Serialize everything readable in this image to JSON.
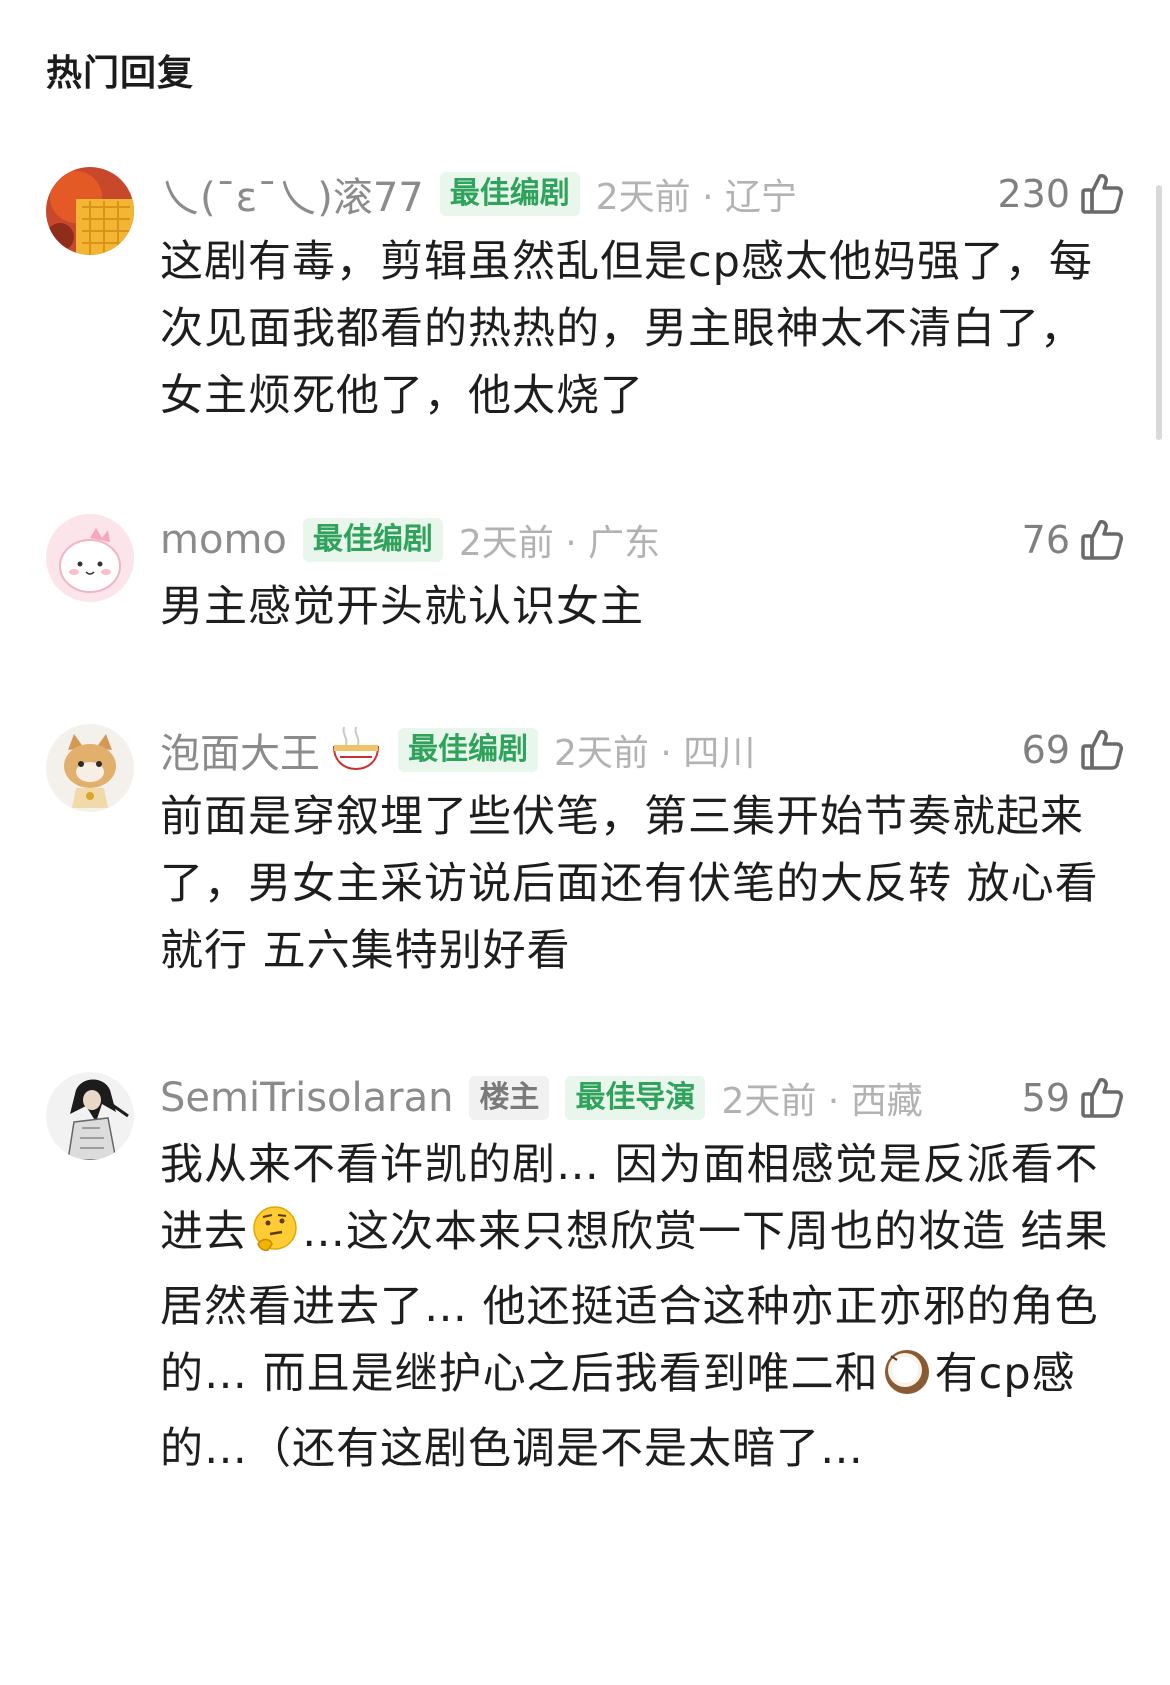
{
  "section_title": "热门回复",
  "comments": [
    {
      "username": "乀(ˉεˉ乀)滚77",
      "badges": [
        "最佳编剧"
      ],
      "time": "2天前",
      "location": "辽宁",
      "likes": "230",
      "text": "这剧有毒，剪辑虽然乱但是cp感太他妈强了，每次见面我都看的热热的，男主眼神太不清白了，女主烦死他了，他太烧了",
      "avatar_icon": "mango-avatar-icon"
    },
    {
      "username": "momo",
      "badges": [
        "最佳编剧"
      ],
      "time": "2天前",
      "location": "广东",
      "likes": "76",
      "text": "男主感觉开头就认识女主",
      "avatar_icon": "pink-cartoon-avatar-icon"
    },
    {
      "username": "泡面大王",
      "username_emoji": "noodle-bowl-icon",
      "badges": [
        "最佳编剧"
      ],
      "time": "2天前",
      "location": "四川",
      "likes": "69",
      "text": "前面是穿叙埋了些伏笔，第三集开始节奏就起来了，男女主采访说后面还有伏笔的大反转 放心看就行 五六集特别好看",
      "avatar_icon": "cat-avatar-icon"
    },
    {
      "username": "SemiTrisolaran",
      "badges": [
        "楼主",
        "最佳导演"
      ],
      "time": "2天前",
      "location": "西藏",
      "likes": "59",
      "text_parts": [
        "我从来不看许凯的剧… 因为面相感觉是反派看不进去",
        "…这次本来只想欣赏一下周也的妆造 结果居然看进去了… 他还挺适合这种亦正亦邪的角色的… 而且是继护心之后我看到唯二和",
        "有cp感的…（还有这剧色调是不是太暗了…"
      ],
      "inline_emojis": [
        "thinking-face-icon",
        "coconut-icon"
      ],
      "avatar_icon": "ink-figure-avatar-icon"
    }
  ],
  "separator": " · ",
  "colors": {
    "badge_green": "#2fa35b",
    "badge_bg": "#e8f6ec",
    "meta_gray": "#b2b2b2",
    "name_gray": "#8b8b8b"
  }
}
